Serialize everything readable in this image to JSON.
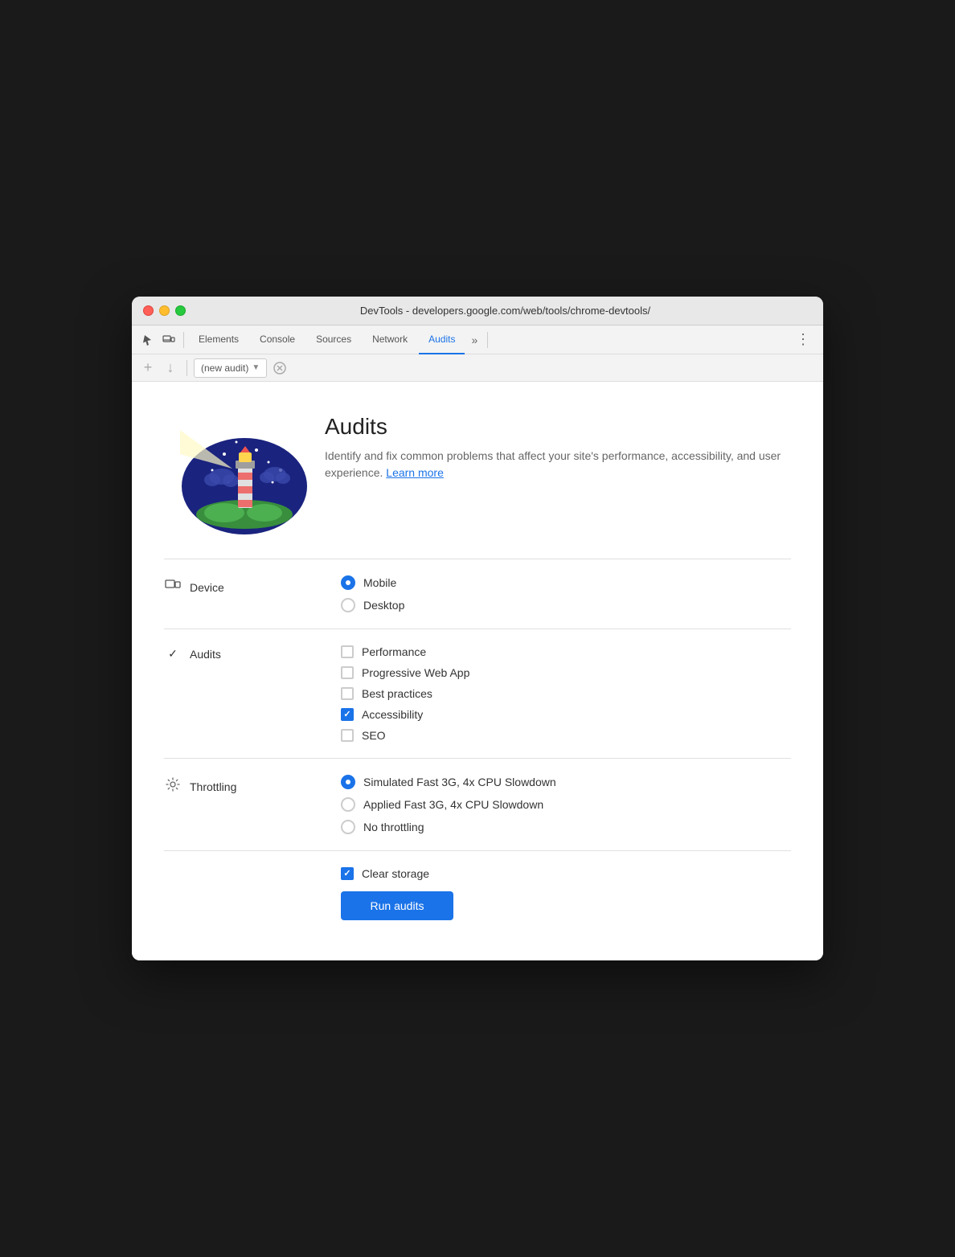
{
  "window": {
    "title": "DevTools - developers.google.com/web/tools/chrome-devtools/"
  },
  "tabs": {
    "items": [
      {
        "label": "Elements",
        "active": false
      },
      {
        "label": "Console",
        "active": false
      },
      {
        "label": "Sources",
        "active": false
      },
      {
        "label": "Network",
        "active": false
      },
      {
        "label": "Audits",
        "active": true
      }
    ],
    "more_label": "»",
    "menu_label": "⋮"
  },
  "audit_toolbar": {
    "dropdown_text": "(new audit)",
    "add_label": "+",
    "download_label": "↓"
  },
  "audits_panel": {
    "title": "Audits",
    "description": "Identify and fix common problems that affect your site's performance, accessibility, and user experience.",
    "learn_more": "Learn more"
  },
  "device_section": {
    "label": "Device",
    "options": [
      {
        "label": "Mobile",
        "type": "radio",
        "checked": true
      },
      {
        "label": "Desktop",
        "type": "radio",
        "checked": false
      }
    ]
  },
  "audits_section": {
    "label": "Audits",
    "options": [
      {
        "label": "Performance",
        "type": "checkbox",
        "checked": false
      },
      {
        "label": "Progressive Web App",
        "type": "checkbox",
        "checked": false
      },
      {
        "label": "Best practices",
        "type": "checkbox",
        "checked": false
      },
      {
        "label": "Accessibility",
        "type": "checkbox",
        "checked": true
      },
      {
        "label": "SEO",
        "type": "checkbox",
        "checked": false
      }
    ]
  },
  "throttling_section": {
    "label": "Throttling",
    "options": [
      {
        "label": "Simulated Fast 3G, 4x CPU Slowdown",
        "type": "radio",
        "checked": true
      },
      {
        "label": "Applied Fast 3G, 4x CPU Slowdown",
        "type": "radio",
        "checked": false
      },
      {
        "label": "No throttling",
        "type": "radio",
        "checked": false
      }
    ]
  },
  "bottom": {
    "clear_storage": {
      "label": "Clear storage",
      "checked": true
    },
    "run_button": "Run audits"
  }
}
